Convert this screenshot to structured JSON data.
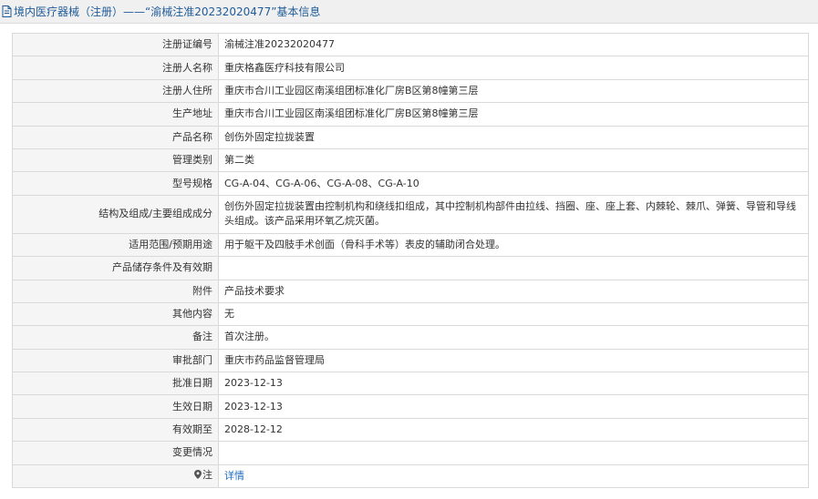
{
  "header": {
    "title": "境内医疗器械（注册）——“渝械注准20232020477”基本信息"
  },
  "rows": [
    {
      "label": "注册证编号",
      "value": "渝械注准20232020477"
    },
    {
      "label": "注册人名称",
      "value": "重庆格鑫医疗科技有限公司"
    },
    {
      "label": "注册人住所",
      "value": "重庆市合川工业园区南溪组团标准化厂房B区第8幢第三层"
    },
    {
      "label": "生产地址",
      "value": "重庆市合川工业园区南溪组团标准化厂房B区第8幢第三层"
    },
    {
      "label": "产品名称",
      "value": "创伤外固定拉拢装置"
    },
    {
      "label": "管理类别",
      "value": "第二类"
    },
    {
      "label": "型号规格",
      "value": "CG-A-04、CG-A-06、CG-A-08、CG-A-10"
    },
    {
      "label": "结构及组成/主要组成成分",
      "value": "创伤外固定拉拢装置由控制机构和绕线扣组成，其中控制机构部件由拉线、挡圈、座、座上套、内棘轮、棘爪、弹簧、导管和导线头组成。该产品采用环氧乙烷灭菌。"
    },
    {
      "label": "适用范围/预期用途",
      "value": "用于躯干及四肢手术创面（骨科手术等）表皮的辅助闭合处理。"
    },
    {
      "label": "产品储存条件及有效期",
      "value": ""
    },
    {
      "label": "附件",
      "value": "产品技术要求"
    },
    {
      "label": "其他内容",
      "value": "无"
    },
    {
      "label": "备注",
      "value": "首次注册。"
    },
    {
      "label": "审批部门",
      "value": "重庆市药品监督管理局"
    },
    {
      "label": "批准日期",
      "value": "2023-12-13"
    },
    {
      "label": "生效日期",
      "value": "2023-12-13"
    },
    {
      "label": "有效期至",
      "value": "2028-12-12"
    },
    {
      "label": "变更情况",
      "value": ""
    }
  ],
  "note_row": {
    "label": "注",
    "link": "详情",
    "icon": "location-pin-icon"
  },
  "colors": {
    "title_text": "#1f5b99",
    "label_bg": "#f5f5f5",
    "link": "#1e6bc2",
    "border": "#d9d9d9"
  }
}
